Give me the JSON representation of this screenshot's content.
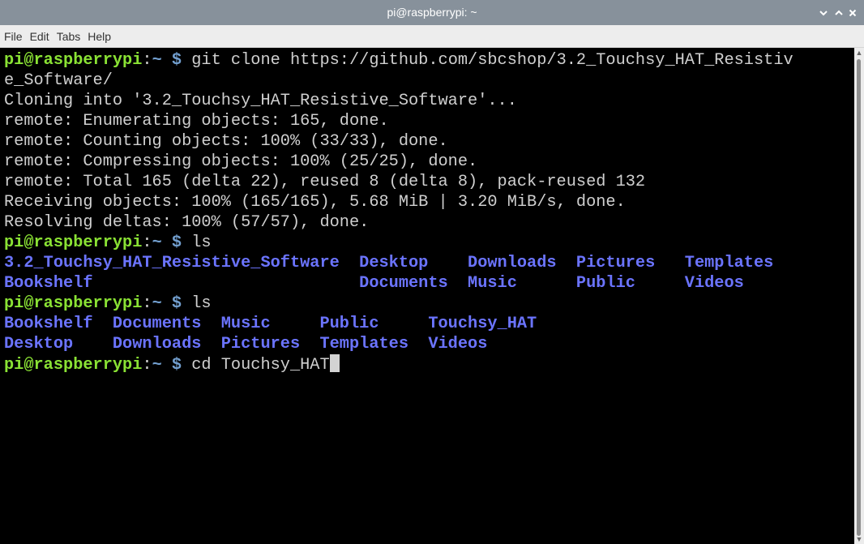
{
  "window": {
    "title": "pi@raspberrypi: ~",
    "controls": {
      "minimize": "⌄",
      "maximize": "^",
      "close": "×"
    }
  },
  "menubar": [
    "File",
    "Edit",
    "Tabs",
    "Help"
  ],
  "prompt": {
    "user_host": "pi@raspberrypi",
    "colon": ":",
    "path": "~",
    "sign": " $ "
  },
  "terminal": {
    "lines": [
      {
        "type": "cmd",
        "text": "git clone https://github.com/sbcshop/3.2_Touchsy_HAT_Resistiv"
      },
      {
        "type": "out",
        "text": "e_Software/"
      },
      {
        "type": "out",
        "text": "Cloning into '3.2_Touchsy_HAT_Resistive_Software'..."
      },
      {
        "type": "out",
        "text": "remote: Enumerating objects: 165, done."
      },
      {
        "type": "out",
        "text": "remote: Counting objects: 100% (33/33), done."
      },
      {
        "type": "out",
        "text": "remote: Compressing objects: 100% (25/25), done."
      },
      {
        "type": "out",
        "text": "remote: Total 165 (delta 22), reused 8 (delta 8), pack-reused 132"
      },
      {
        "type": "out",
        "text": "Receiving objects: 100% (165/165), 5.68 MiB | 3.20 MiB/s, done."
      },
      {
        "type": "out",
        "text": "Resolving deltas: 100% (57/57), done."
      },
      {
        "type": "cmd",
        "text": "ls"
      },
      {
        "type": "dir",
        "text": "3.2_Touchsy_HAT_Resistive_Software  Desktop    Downloads  Pictures   Templates"
      },
      {
        "type": "dir",
        "text": "Bookshelf                           Documents  Music      Public     Videos"
      },
      {
        "type": "cmd",
        "text": "ls"
      },
      {
        "type": "dir",
        "text": "Bookshelf  Documents  Music     Public     Touchsy_HAT"
      },
      {
        "type": "dir",
        "text": "Desktop    Downloads  Pictures  Templates  Videos"
      },
      {
        "type": "cmd",
        "text": "cd Touchsy_HAT",
        "cursor": true
      }
    ]
  },
  "colors": {
    "titlebar": "#87919b",
    "prompt_user": "#8ae234",
    "prompt_path": "#729fcf",
    "directory": "#6b74ff",
    "text": "#cfcfcf",
    "background": "#000000"
  }
}
